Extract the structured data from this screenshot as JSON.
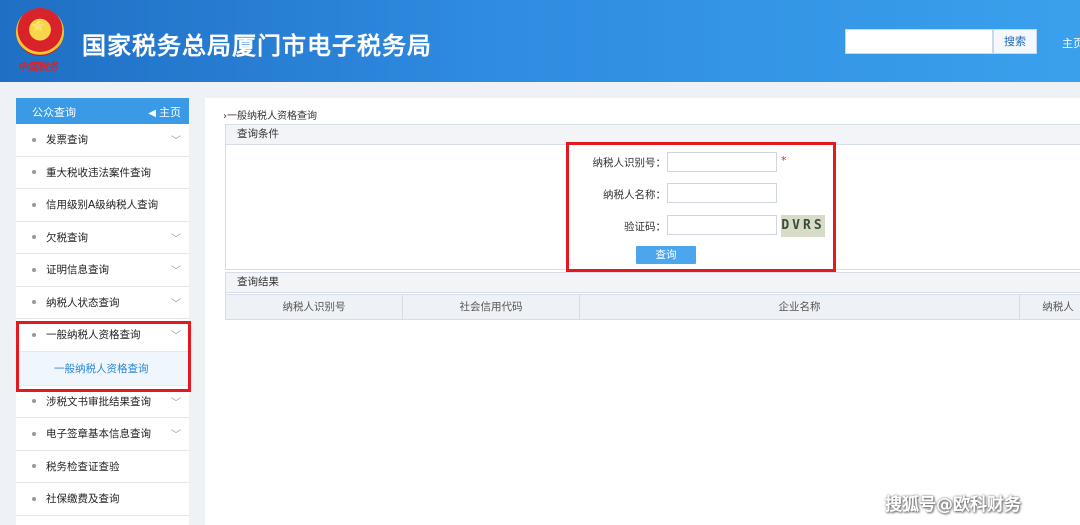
{
  "header": {
    "site_title": "国家税务总局厦门市电子税务局",
    "seal_text": "中国税务",
    "search_placeholder": "",
    "search_button": "搜索",
    "home_link": "主页"
  },
  "sidebar": {
    "title": "公众查询",
    "home_label": "主页",
    "items": [
      {
        "label": "发票查询",
        "has_chevron": true
      },
      {
        "label": "重大税收违法案件查询",
        "has_chevron": false
      },
      {
        "label": "信用级别A级纳税人查询",
        "has_chevron": false
      },
      {
        "label": "欠税查询",
        "has_chevron": true
      },
      {
        "label": "证明信息查询",
        "has_chevron": true
      },
      {
        "label": "纳税人状态查询",
        "has_chevron": true
      },
      {
        "label": "一般纳税人资格查询",
        "has_chevron": true,
        "expanded": true
      },
      {
        "label": "涉税文书审批结果查询",
        "has_chevron": true
      },
      {
        "label": "电子签章基本信息查询",
        "has_chevron": true
      },
      {
        "label": "税务检查证查验",
        "has_chevron": false
      },
      {
        "label": "社保缴费及查询",
        "has_chevron": false
      }
    ],
    "subitem": "一般纳税人资格查询"
  },
  "main": {
    "breadcrumb": "›一般纳税人资格查询",
    "query_panel_title": "查询条件",
    "fields": {
      "taxpayer_id_label": "纳税人识别号：",
      "taxpayer_name_label": "纳税人名称：",
      "captcha_label": "验证码：",
      "required_mark": "*",
      "taxpayer_id_value": "",
      "taxpayer_name_value": "",
      "captcha_value": ""
    },
    "captcha_image_text": "DVRS",
    "query_button": "查询",
    "result_panel_title": "查询结果",
    "columns": [
      "纳税人识别号",
      "社会信用代码",
      "企业名称",
      "纳税人"
    ]
  },
  "watermark": "搜狐号@欧科财务",
  "colors": {
    "header_blue": "#2f8be0",
    "sidebar_head": "#3a9ae6",
    "highlight_red": "#e3191f",
    "button_blue": "#4ba6ee"
  }
}
